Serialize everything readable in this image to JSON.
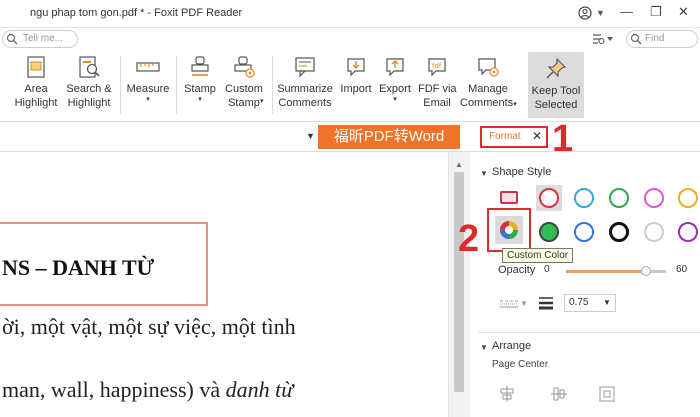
{
  "window": {
    "title": "ngu phap tom gon.pdf * - Foxit PDF Reader",
    "minimize_glyph": "—",
    "restore_glyph": "❐",
    "close_glyph": "✕"
  },
  "search": {
    "tell_me_placeholder": "Tell me...",
    "find_placeholder": "Find"
  },
  "ribbon": {
    "buttons": [
      {
        "label1": "Area",
        "label2": "Highlight",
        "icon": "area-highlight-icon"
      },
      {
        "label1": "Search &",
        "label2": "Highlight",
        "icon": "search-highlight-icon"
      },
      {
        "label1": "Measure",
        "label2": "",
        "icon": "measure-icon",
        "dropdown": "▾"
      },
      {
        "label1": "Stamp",
        "label2": "",
        "icon": "stamp-icon",
        "dropdown": "▾"
      },
      {
        "label1": "Custom",
        "label2": "Stamp",
        "icon": "custom-stamp-icon",
        "dropdown": "▾"
      },
      {
        "label1": "Summarize",
        "label2": "Comments",
        "icon": "summarize-comments-icon"
      },
      {
        "label1": "Import",
        "label2": "",
        "icon": "import-icon"
      },
      {
        "label1": "Export",
        "label2": "",
        "icon": "export-icon",
        "dropdown": "▾"
      },
      {
        "label1": "FDF via",
        "label2": "Email",
        "icon": "fdf-email-icon"
      },
      {
        "label1": "Manage",
        "label2": "Comments",
        "icon": "manage-comments-icon",
        "dropdown": "▾"
      },
      {
        "label1": "Keep Tool",
        "label2": "Selected",
        "icon": "keep-tool-pin-icon"
      }
    ]
  },
  "docstrip": {
    "dropdown_glyph": "▼",
    "fuxin_banner": "福昕PDF转Word",
    "format_tab_label": "Format",
    "format_tab_close": "✕",
    "annotation_1": "1"
  },
  "document": {
    "heading": "NS – DANH TỪ",
    "line2": "ời, một vật, một sự việc, một tình",
    "line3_plain": "man, wall, happiness) và ",
    "line3_italic": "danh từ"
  },
  "panel": {
    "shape_style_title": "Shape Style",
    "custom_color_tooltip": "Custom Color",
    "annotation_2": "2",
    "opacity_label": "Opacity",
    "opacity_min": "0",
    "opacity_max": "60",
    "opacity_value_fraction": 0.8,
    "line_width_value": "0.75",
    "arrange_title": "Arrange",
    "page_center_label": "Page Center",
    "swatch_colors_row1": [
      "#d9333f",
      "#3aa6dd",
      "#2fa84f",
      "#e05ad0",
      "#e8b020"
    ],
    "swatch_colors_row2": [
      "#2fbd57",
      "#3b6fd8",
      "#111111",
      "#cccccc",
      "#9b2fb8"
    ]
  }
}
